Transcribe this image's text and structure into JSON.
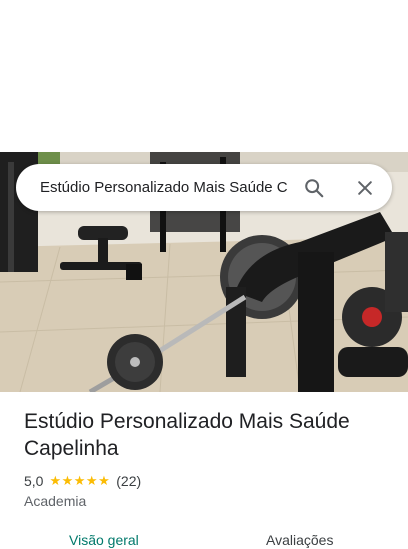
{
  "search": {
    "query": "Estúdio Personalizado Mais Saúde C"
  },
  "place": {
    "title": "Estúdio Personalizado Mais Saúde Capelinha",
    "rating": "5,0",
    "stars": "★★★★★",
    "review_count": "(22)",
    "category": "Academia"
  },
  "tabs": [
    {
      "label": "Visão geral",
      "active": true
    },
    {
      "label": "Avaliações",
      "active": false
    }
  ],
  "colors": {
    "accent": "#00796b",
    "star": "#fbbc04"
  },
  "icons": {
    "search": "search-icon",
    "close": "close-icon"
  }
}
